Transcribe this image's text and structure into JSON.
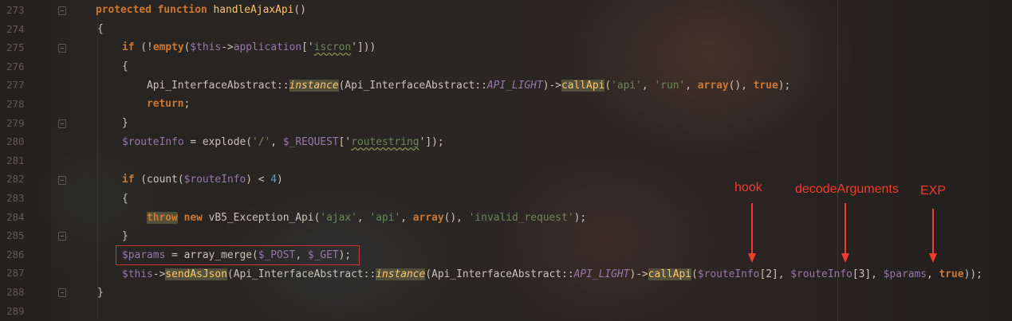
{
  "line_numbers": [
    "273",
    "274",
    "275",
    "276",
    "277",
    "278",
    "279",
    "280",
    "281",
    "282",
    "283",
    "284",
    "285",
    "286",
    "287",
    "288",
    "289"
  ],
  "code": {
    "l273": {
      "kw1": "protected",
      "kw2": "function",
      "name": "handleAjaxApi",
      "rest": "()"
    },
    "l274": {
      "text": "{"
    },
    "l275": {
      "kw": "if",
      "p1": " (!",
      "fn": "empty",
      "p2": "(",
      "var": "$this",
      "arrow": "->",
      "prop": "application",
      "b1": "['",
      "key": "iscron",
      "b2": "'])",
      ")": ")"
    },
    "l276": {
      "text": "{"
    },
    "l277": {
      "cls": "Api_InterfaceAbstract::",
      "method": "instance",
      "p1": "(",
      "cls2": "Api_InterfaceAbstract::",
      "const": "API_LIGHT",
      "p2": ")->",
      "call": "callApi",
      "p3": "(",
      "s1": "'api'",
      "c1": ", ",
      "s2": "'run'",
      "c2": ", ",
      "arr": "array",
      "p4": "(), ",
      "t": "true",
      "end": ");"
    },
    "l278": {
      "kw": "return",
      "end": ";"
    },
    "l279": {
      "text": "}"
    },
    "l280": {
      "var": "$routeInfo",
      "mid": " = explode(",
      "s1": "'/'",
      "c1": ", ",
      "var2": "$_REQUEST",
      "b1": "['",
      "key": "routestring",
      "b2": "']",
      "end": ");"
    },
    "l282": {
      "kw": "if",
      "p1": " (count(",
      "var": "$routeInfo",
      "end": ") < ",
      "num": "4",
      ")": ")"
    },
    "l283": {
      "text": "{"
    },
    "l284": {
      "kw1": "throw",
      "sp": " ",
      "kw2": "new",
      "cls": " vB5_Exception_Api(",
      "s1": "'ajax'",
      "c1": ", ",
      "s2": "'api'",
      "c2": ", ",
      "arr": "array",
      "p": "(), ",
      "s3": "'invalid_request'",
      "end": ");"
    },
    "l285": {
      "text": "}"
    },
    "l286": {
      "var": "$params",
      "mid": " = array_merge(",
      "v1": "$_POST",
      "c": ", ",
      "v2": "$_GET",
      "end": ");"
    },
    "l287": {
      "var": "$this",
      "arrow": "->",
      "m1": "sendAsJson",
      "p1": "(",
      "cls": "Api_InterfaceAbstract::",
      "method": "instance",
      "p2": "(",
      "cls2": "Api_InterfaceAbstract::",
      "const": "API_LIGHT",
      "p3": ")->",
      "call": "callApi",
      "p4": "(",
      "v1": "$routeInfo",
      "i1": "[2], ",
      "v2": "$routeInfo",
      "i2": "[3], ",
      "v3": "$params",
      "c": ", ",
      "t": "true",
      "end": "));"
    },
    "l288": {
      "text": "}"
    }
  },
  "annotations": {
    "hook": "hook",
    "decode": "decodeArguments",
    "exp": "EXP",
    "color": "#f13b2f"
  },
  "colors": {
    "keyword": "#cc7832",
    "variable": "#9876aa",
    "string": "#6a8759",
    "number": "#6897bb",
    "highlight_bg": "#52503a",
    "highlight_fg": "#ffc66d",
    "box": "#c9372c"
  }
}
